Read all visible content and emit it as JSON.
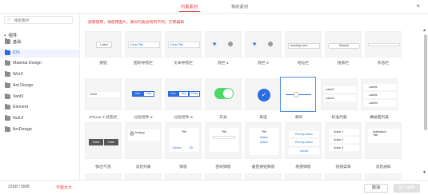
{
  "header": {
    "tabs": [
      {
        "label": "内置素材",
        "active": true
      },
      {
        "label": "我的素材",
        "active": false
      }
    ],
    "close_glyph": "×"
  },
  "sidebar": {
    "search_placeholder": "搜索素材",
    "root_label": "组件",
    "items": [
      {
        "label": "基础",
        "active": false
      },
      {
        "label": "iOS",
        "active": true
      },
      {
        "label": "Material Design",
        "active": false
      },
      {
        "label": "WeUI",
        "active": false
      },
      {
        "label": "Ant Design",
        "active": false
      },
      {
        "label": "Vant3",
        "active": false
      },
      {
        "label": "Element",
        "active": false
      },
      {
        "label": "NutUI",
        "active": false
      },
      {
        "label": "ArcDesign",
        "active": false
      }
    ]
  },
  "main": {
    "notice": "按需使用，请使用图片，素材可能会有所不同，方便编辑",
    "tiles": [
      {
        "label": "按钮",
        "content": "Label"
      },
      {
        "label": "图标导航栏",
        "content": "Clear Title"
      },
      {
        "label": "文本导航栏",
        "content": "Clear Title"
      },
      {
        "label": "底栏-1",
        "content": ""
      },
      {
        "label": "底栏-2",
        "content": ""
      },
      {
        "label": "地址栏",
        "content": "mockup.com"
      },
      {
        "label": "搜索栏",
        "content": "Search"
      },
      {
        "label": "状态栏",
        "content": ""
      },
      {
        "label": "iPhone X 状态栏",
        "content": "13:00"
      },
      {
        "label": "分段控件-2",
        "content_a": "One",
        "content_b": "Two"
      },
      {
        "label": "分段控件-3",
        "content_a": "One",
        "content_b": "Two",
        "content_c": "Three"
      },
      {
        "label": "开关",
        "content": ""
      },
      {
        "label": "单选",
        "content": ""
      },
      {
        "label": "滑块",
        "content": ""
      },
      {
        "label": "标准列表",
        "content_a": "Label1",
        "content_b": "Label2"
      },
      {
        "label": "横幅图列表",
        "content_a": "Label1",
        "content_b": "Label2",
        "content_c": "Label3"
      },
      {
        "label": "弹出气泡",
        "content_a": "Share",
        "content_b": "Paste"
      },
      {
        "label": "消息列表",
        "content_a": "Mockup",
        "content_b": "Today"
      },
      {
        "label": "弹窗",
        "content_a": "Title",
        "content_b": "Cancel",
        "content_c": "OK"
      },
      {
        "label": "密码弹窗",
        "content": "Title"
      },
      {
        "label": "垂直按钮弹窗",
        "content_a": "Title",
        "content_b": "Option"
      },
      {
        "label": "底部弹窗",
        "content_a": "Primary Action",
        "content_b": "Cancel"
      },
      {
        "label": "快捷菜单",
        "content_a": "Action 1",
        "content_b": "Action 2",
        "content_c": "Action 3"
      },
      {
        "label": "消息通知",
        "content_a": "Notification",
        "content_b": "Title"
      }
    ]
  },
  "footer": {
    "size_text": "22KB / 5MB",
    "size_warning": "不能太大",
    "cancel_label": "取消",
    "add_label": "插入画板"
  },
  "colors": {
    "accent_red": "#e53935",
    "accent_blue": "#2d6cdf",
    "switch_green": "#4cd964"
  }
}
